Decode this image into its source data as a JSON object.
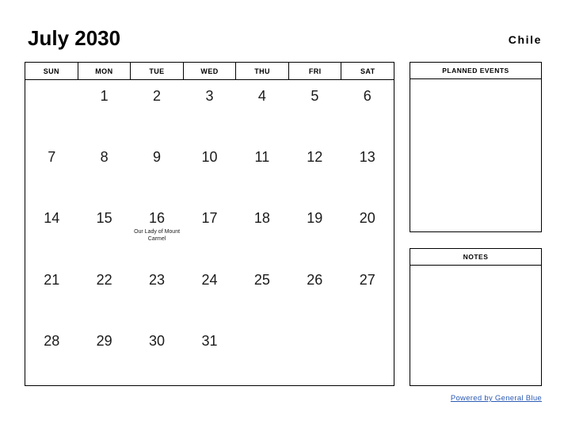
{
  "header": {
    "title": "July 2030",
    "country": "Chile"
  },
  "calendar": {
    "weekdays": [
      "SUN",
      "MON",
      "TUE",
      "WED",
      "THU",
      "FRI",
      "SAT"
    ],
    "weeks": [
      [
        {
          "day": "",
          "event": ""
        },
        {
          "day": "1",
          "event": ""
        },
        {
          "day": "2",
          "event": ""
        },
        {
          "day": "3",
          "event": ""
        },
        {
          "day": "4",
          "event": ""
        },
        {
          "day": "5",
          "event": ""
        },
        {
          "day": "6",
          "event": ""
        }
      ],
      [
        {
          "day": "7",
          "event": ""
        },
        {
          "day": "8",
          "event": ""
        },
        {
          "day": "9",
          "event": ""
        },
        {
          "day": "10",
          "event": ""
        },
        {
          "day": "11",
          "event": ""
        },
        {
          "day": "12",
          "event": ""
        },
        {
          "day": "13",
          "event": ""
        }
      ],
      [
        {
          "day": "14",
          "event": ""
        },
        {
          "day": "15",
          "event": ""
        },
        {
          "day": "16",
          "event": "Our Lady of Mount Carmel"
        },
        {
          "day": "17",
          "event": ""
        },
        {
          "day": "18",
          "event": ""
        },
        {
          "day": "19",
          "event": ""
        },
        {
          "day": "20",
          "event": ""
        }
      ],
      [
        {
          "day": "21",
          "event": ""
        },
        {
          "day": "22",
          "event": ""
        },
        {
          "day": "23",
          "event": ""
        },
        {
          "day": "24",
          "event": ""
        },
        {
          "day": "25",
          "event": ""
        },
        {
          "day": "26",
          "event": ""
        },
        {
          "day": "27",
          "event": ""
        }
      ],
      [
        {
          "day": "28",
          "event": ""
        },
        {
          "day": "29",
          "event": ""
        },
        {
          "day": "30",
          "event": ""
        },
        {
          "day": "31",
          "event": ""
        },
        {
          "day": "",
          "event": ""
        },
        {
          "day": "",
          "event": ""
        },
        {
          "day": "",
          "event": ""
        }
      ]
    ]
  },
  "panels": {
    "planned_events": {
      "title": "PLANNED EVENTS",
      "content": ""
    },
    "notes": {
      "title": "NOTES",
      "content": ""
    }
  },
  "footer": {
    "link_text": "Powered by General Blue",
    "link_color": "#2b5ab5"
  }
}
